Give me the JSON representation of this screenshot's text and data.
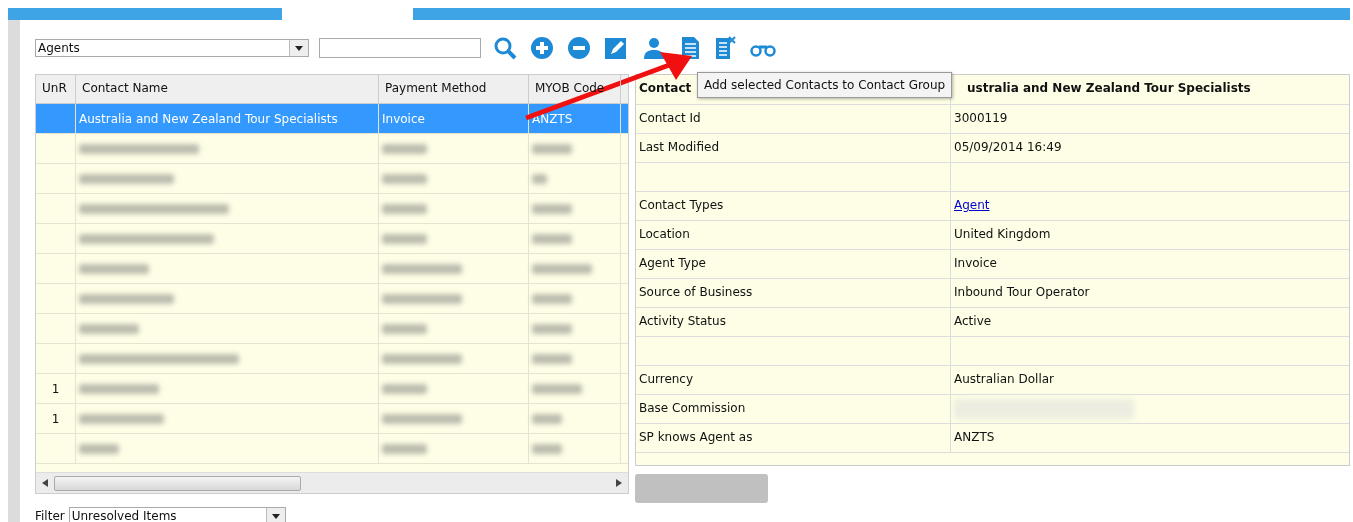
{
  "toolbar": {
    "category": "Agents"
  },
  "tooltip": "Add selected Contacts to Contact Group",
  "table": {
    "columns": [
      "UnR",
      "Contact Name",
      "Payment Method",
      "MYOB Code"
    ],
    "rows": [
      {
        "unr": "",
        "name": "Australia and New Zealand Tour Specialists",
        "payment": "Invoice",
        "code": "ANZTS",
        "selected": true,
        "blurred": false
      },
      {
        "unr": "",
        "selected": false,
        "blurred": true
      },
      {
        "unr": "",
        "selected": false,
        "blurred": true
      },
      {
        "unr": "",
        "selected": false,
        "blurred": true
      },
      {
        "unr": "",
        "selected": false,
        "blurred": true
      },
      {
        "unr": "",
        "selected": false,
        "blurred": true
      },
      {
        "unr": "",
        "selected": false,
        "blurred": true
      },
      {
        "unr": "",
        "selected": false,
        "blurred": true
      },
      {
        "unr": "",
        "selected": false,
        "blurred": true
      },
      {
        "unr": "1",
        "selected": false,
        "blurred": true
      },
      {
        "unr": "1",
        "selected": false,
        "blurred": true
      },
      {
        "unr": "",
        "selected": false,
        "blurred": true
      }
    ]
  },
  "details": {
    "header_label": "Contact",
    "header_value": "ustralia and New Zealand Tour Specialists",
    "rows": [
      {
        "label": "Contact Id",
        "value": "3000119"
      },
      {
        "label": "Last Modified",
        "value": "05/09/2014 16:49"
      },
      {
        "kind": "blank"
      },
      {
        "label": "Contact Types",
        "value": "Agent",
        "kind": "link"
      },
      {
        "label": "Location",
        "value": "United Kingdom"
      },
      {
        "label": "Agent Type",
        "value": "Invoice"
      },
      {
        "label": "Source of Business",
        "value": "Inbound Tour Operator"
      },
      {
        "label": "Activity Status",
        "value": "Active"
      },
      {
        "kind": "blank"
      },
      {
        "label": "Currency",
        "value": "Australian Dollar"
      },
      {
        "label": "Base Commission",
        "kind": "blurred"
      },
      {
        "label": "SP knows Agent as",
        "value": "ANZTS"
      }
    ]
  },
  "filter": {
    "label": "Filter",
    "value": "Unresolved Items"
  }
}
